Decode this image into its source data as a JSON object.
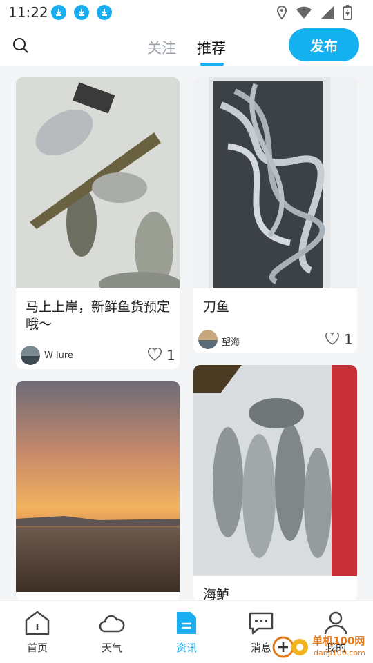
{
  "status_bar": {
    "time": "11:22"
  },
  "top_nav": {
    "tabs": [
      {
        "label": "关注",
        "active": false
      },
      {
        "label": "推荐",
        "active": true
      }
    ],
    "publish_label": "发布"
  },
  "feed": [
    {
      "title": "马上上岸，新鲜鱼货预定哦～",
      "user": "W lure",
      "likes": "1"
    },
    {
      "title": "刀鱼",
      "user": "望海",
      "likes": "1"
    },
    {
      "title": "",
      "user": "",
      "likes": ""
    },
    {
      "title": "海鲈",
      "user": "",
      "likes": ""
    }
  ],
  "bottom_nav": {
    "items": [
      {
        "label": "首页",
        "icon": "home-icon"
      },
      {
        "label": "天气",
        "icon": "cloud-icon"
      },
      {
        "label": "资讯",
        "icon": "news-icon",
        "active": true
      },
      {
        "label": "消息",
        "icon": "message-icon"
      },
      {
        "label": "我的",
        "icon": "profile-icon"
      }
    ]
  },
  "watermark": {
    "line1": "单机100网",
    "line2": "danji100.com"
  },
  "colors": {
    "accent": "#19aef2",
    "publish": "#14b0f0"
  }
}
